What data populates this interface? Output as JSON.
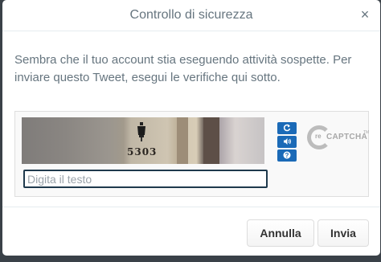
{
  "dialog": {
    "title": "Controllo di sicurezza",
    "close_symbol": "×",
    "message": "Sembra che il tuo account stia eseguendo attività sospette. Per inviare questo Tweet, esegui le verifiche qui sotto."
  },
  "captcha": {
    "image_text": "5303",
    "input_placeholder": "Digita il testo",
    "input_value": "",
    "buttons": {
      "reload_icon": "reload-icon",
      "audio_icon": "audio-icon",
      "help_icon": "help-icon"
    },
    "logo": {
      "re": "re",
      "name": "CAPTCHA",
      "tm": "TM"
    }
  },
  "footer": {
    "cancel_label": "Annulla",
    "send_label": "Invia"
  },
  "colors": {
    "accent": "#1b6ab7",
    "text": "#66757f",
    "backdrop": "#3a4148"
  }
}
